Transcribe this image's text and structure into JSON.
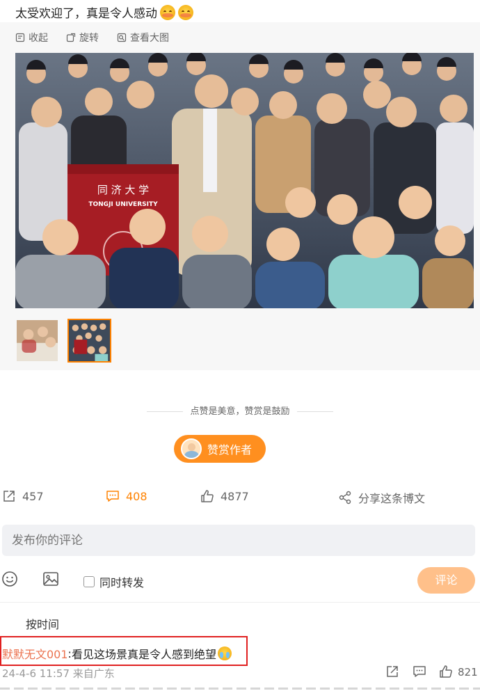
{
  "post": {
    "text": "太受欢迎了，真是令人感动",
    "emojis": [
      "blushing-face-icon",
      "blushing-face-icon"
    ]
  },
  "media": {
    "toolbar": [
      {
        "label": "收起",
        "icon": "collapse-icon"
      },
      {
        "label": "旋转",
        "icon": "rotate-icon"
      },
      {
        "label": "查看大图",
        "icon": "view-large-icon"
      }
    ],
    "photo_sign_text": "同 济 大 学",
    "photo_sign_subtext": "TONGJI UNIVERSITY",
    "thumbnail_count": 2,
    "active_thumbnail": 2
  },
  "reward": {
    "divider_text": "点赞是美意，赞赏是鼓励",
    "button_label": "赞赏作者"
  },
  "actions": {
    "repost_count": "457",
    "comment_count": "408",
    "like_count": "4877",
    "share_label": "分享这条博文"
  },
  "composer": {
    "placeholder": "发布你的评论",
    "repost_checkbox_label": "同时转发",
    "submit_label": "评论"
  },
  "comments": {
    "sort_label": "按时间",
    "first": {
      "user": "默默无文001",
      "separator": ":",
      "text": "看见这场景真是令人感到绝望",
      "emoji": "crying-face-icon",
      "meta": "24-4-6 11:57 来自广东",
      "like_count": "821"
    }
  },
  "colors": {
    "accent": "#ff8200",
    "reward_button": "#ff8f1f",
    "submit_button": "#ffc08a",
    "username": "#eb7350",
    "highlight_box": "#e02020"
  }
}
